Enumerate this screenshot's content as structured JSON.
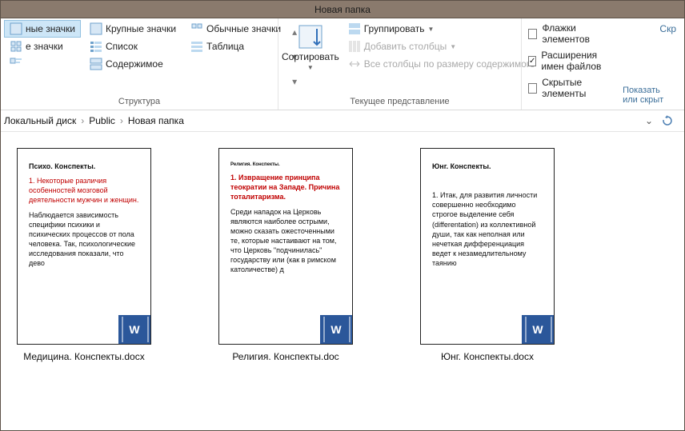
{
  "title": "Новая папка",
  "ribbon": {
    "layout": {
      "group_label": "Структура",
      "huge_icons": "ные значки",
      "big_icons": "Крупные значки",
      "normal_icons": "Обычные значки",
      "small_icons": "е значки",
      "list": "Список",
      "table": "Таблица",
      "content": "Содержимое"
    },
    "view": {
      "group_label": "Текущее представление",
      "sort": "Сортировать",
      "group": "Группировать",
      "add_columns": "Добавить столбцы",
      "autosize": "Все столбцы по размеру содержимого"
    },
    "show": {
      "flags": "Флажки элементов",
      "extensions": "Расширения имен файлов",
      "hidden": "Скрытые элементы",
      "extensions_checked": true
    },
    "right_top": "Скр",
    "right_bottom": "Показать или скрыт"
  },
  "breadcrumb": {
    "segs": [
      "Локальный диск",
      "Public",
      "Новая папка"
    ]
  },
  "files": [
    {
      "filename": "Медицина. Конспекты.docx",
      "preview_title": "Психо. Конспекты.",
      "preview_red": "1. Некоторые различия особенностей мозговой деятельности мужчин и женщин.",
      "preview_body": "Наблюдается зависимость специфики психики и психических процессов от пола человека. Так, психологические исследования показали, что дево"
    },
    {
      "filename": "Религия. Конспекты.doc",
      "preview_title": "Религия. Конспекты.",
      "preview_red": "1. Извращение принципа теократии на Западе. Причина тоталитаризма.",
      "preview_body": "Среди нападок на Церковь являются наиболее острыми, можно сказать ожесточенными те, которые настаивают на том, что Церковь \"подчинилась\" государству или (как в римском католичестве) д"
    },
    {
      "filename": "Юнг. Конспекты.docx",
      "preview_title": "Юнг. Конспекты.",
      "preview_red": "",
      "preview_body": "1. Итак, для развития личности совершенно необходимо строгое выделение себя (differentation) из коллективной души, так как неполная или нечеткая дифференциация ведет к незамедлительному таянию"
    }
  ]
}
